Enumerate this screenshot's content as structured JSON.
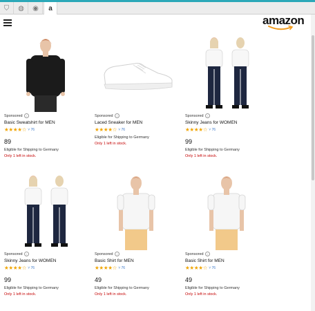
{
  "tabs": [
    {
      "icon": "filter-icon",
      "glyph": "⛉"
    },
    {
      "icon": "tag-icon",
      "glyph": "◍"
    },
    {
      "icon": "eye-icon",
      "glyph": "◉"
    },
    {
      "icon": "amazon-tab-icon",
      "glyph": "a"
    }
  ],
  "brand": {
    "logo_text": "amazon",
    "smile_color": "#f29b1d"
  },
  "colors": {
    "star": "#f0a400",
    "link": "#3a77c8",
    "stock": "#c40000",
    "accent": "#2ba8b8"
  },
  "products": [
    {
      "sponsored": "Sponsored",
      "title": "Basic Sweatshirt for MEN",
      "stars": "★★★★☆",
      "reviews": "˅ 76",
      "price": "89",
      "shipping": "Eligible for Shipping to Germany",
      "stock": "Only 1 left in stock.",
      "image": "black sweatshirt model"
    },
    {
      "sponsored": "Sponsored",
      "title": "Laced Sneaker for MEN",
      "stars": "★★★★☆",
      "reviews": "˅ 76",
      "price": "",
      "shipping": "Eligible for Shipping to Germany",
      "stock": "Only 1 left in stock.",
      "image": "white sneaker"
    },
    {
      "sponsored": "Sponsored",
      "title": "Skinny Jeans for WOMEN",
      "stars": "★★★★☆",
      "reviews": "˅ 76",
      "price": "99",
      "shipping": "Eligible for Shipping to Germany",
      "stock": "Only 1 left in stock.",
      "image": "skinny jeans model"
    },
    {
      "sponsored": "Sponsored",
      "title": "Skinny Jeans for WOMEN",
      "stars": "★★★★☆",
      "reviews": "˅ 76",
      "price": "99",
      "shipping": "Eligible for Shipping to Germany",
      "stock": "Only 1 left in stock.",
      "image": "skinny jeans model"
    },
    {
      "sponsored": "Sponsored",
      "title": "Basic Shirt for MEN",
      "stars": "★★★★☆",
      "reviews": "˅ 76",
      "price": "49",
      "shipping": "Eligible for Shipping to Germany",
      "stock": "Only 1 left in stock.",
      "image": "white t-shirt model"
    },
    {
      "sponsored": "Sponsored",
      "title": "Basic Shirt for MEN",
      "stars": "★★★★☆",
      "reviews": "˅ 76",
      "price": "49",
      "shipping": "Eligible for Shipping to Germany",
      "stock": "Only 1 left in stock.",
      "image": "white t-shirt model"
    }
  ]
}
